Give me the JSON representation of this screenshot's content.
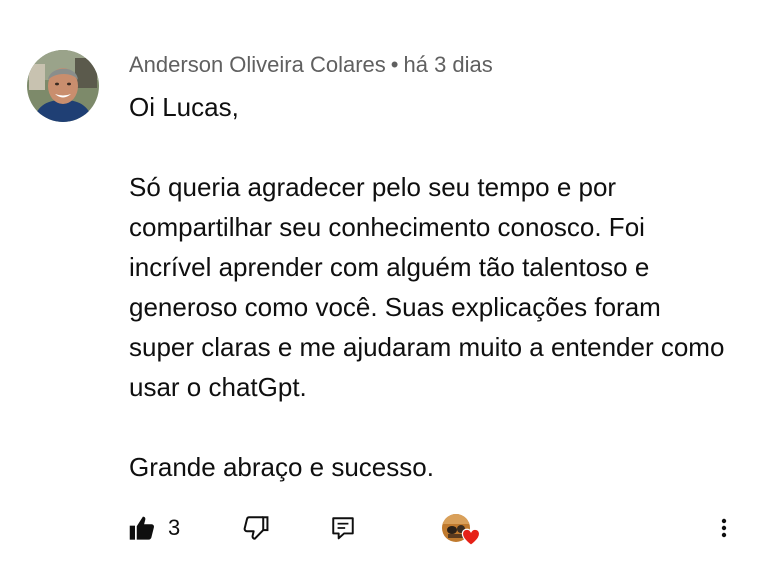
{
  "comment": {
    "author": "Anderson Oliveira Colares",
    "separator": "•",
    "time": "há 3 dias",
    "paragraphs": [
      "Oi Lucas,",
      "Só queria agradecer pelo seu tempo e por compartilhar seu conhecimento conosco. Foi incrível aprender com alguém tão talentoso e generoso como você. Suas explicações foram super claras e me ajudaram muito a entender como usar o chatGpt.",
      "Grande abraço e sucesso."
    ],
    "like_count": "3"
  },
  "icons": {
    "like": "thumbs-up-icon",
    "dislike": "thumbs-down-icon",
    "reply": "reply-icon",
    "creator_heart": "creator-heart-icon",
    "more": "more-vert-icon"
  },
  "colors": {
    "text_primary": "#0f0f0f",
    "text_secondary": "#606060",
    "heart": "#e62117"
  }
}
